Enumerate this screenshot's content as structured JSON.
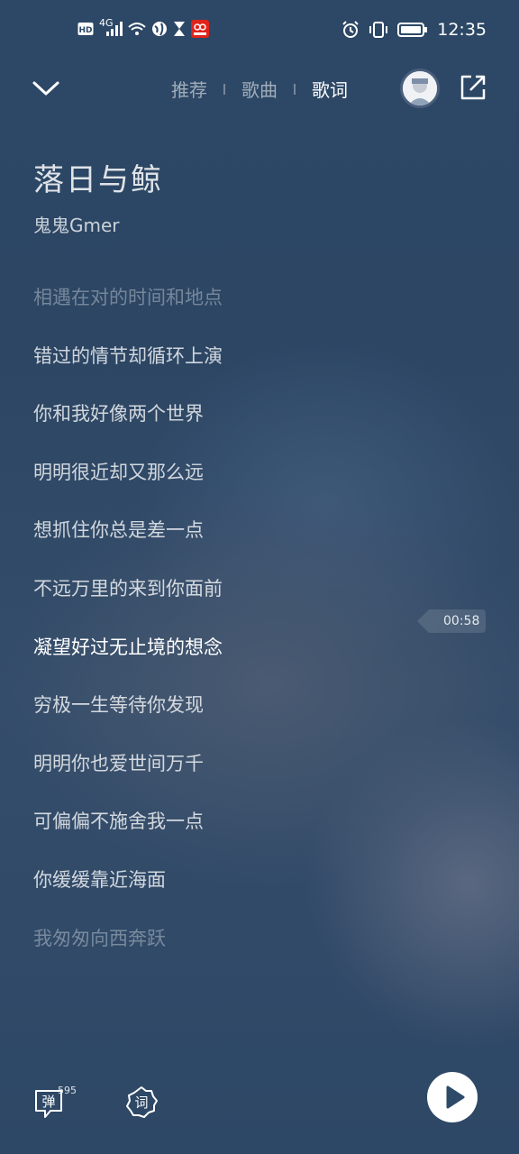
{
  "status_bar": {
    "left_badges": [
      "HD",
      "4G"
    ],
    "time": "12:35"
  },
  "header": {
    "tabs": [
      {
        "label": "推荐",
        "active": false
      },
      {
        "label": "歌曲",
        "active": false
      },
      {
        "label": "歌词",
        "active": true
      }
    ]
  },
  "song": {
    "title": "落日与鲸",
    "artist": "鬼鬼Gmer"
  },
  "lyrics": [
    {
      "text": "相遇在对的时间和地点",
      "state": "dim"
    },
    {
      "text": "错过的情节却循环上演",
      "state": "normal"
    },
    {
      "text": "你和我好像两个世界",
      "state": "normal"
    },
    {
      "text": "明明很近却又那么远",
      "state": "normal"
    },
    {
      "text": "想抓住你总是差一点",
      "state": "normal"
    },
    {
      "text": "不远万里的来到你面前",
      "state": "normal"
    },
    {
      "text": "凝望好过无止境的想念",
      "state": "current"
    },
    {
      "text": "穷极一生等待你发现",
      "state": "normal"
    },
    {
      "text": "明明你也爱世间万千",
      "state": "normal"
    },
    {
      "text": "可偏偏不施舍我一点",
      "state": "normal"
    },
    {
      "text": "你缓缓靠近海面",
      "state": "normal"
    },
    {
      "text": "我匆匆向西奔跃",
      "state": "dim"
    }
  ],
  "seek_time": "00:58",
  "bottom": {
    "danmu_label": "弹",
    "danmu_count": "595",
    "lyric_label": "词"
  },
  "icons": {
    "back": "chevron-down-icon",
    "share": "share-icon",
    "play": "play-icon",
    "danmu": "danmu-icon",
    "lyric": "lyric-icon"
  },
  "colors": {
    "accent": "#ffffff",
    "background": "#2d4866"
  }
}
